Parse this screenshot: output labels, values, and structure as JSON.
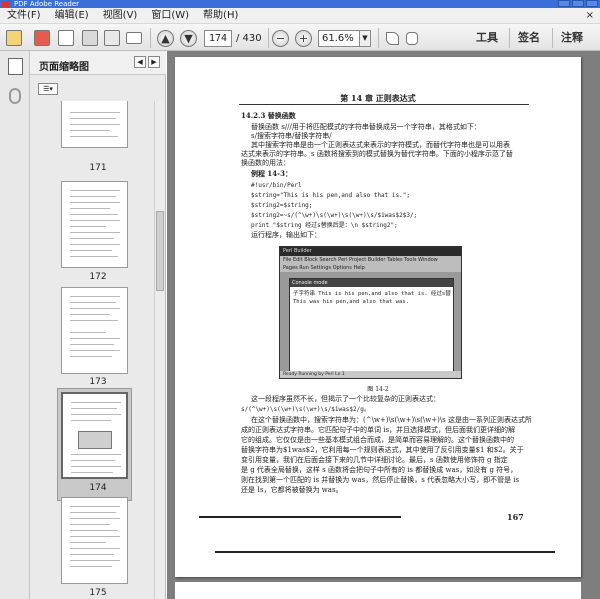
{
  "window": {
    "title": "PDF  Adobe Reader"
  },
  "menu": {
    "file": "文件(F)",
    "edit": "编辑(E)",
    "view": "视图(V)",
    "window": "窗口(W)",
    "help": "帮助(H)",
    "close": "×"
  },
  "toolbar": {
    "page_current": "174",
    "page_total": "/ 430",
    "zoom": "61.6%",
    "tools": "工具",
    "sign": "签名",
    "comment": "注释",
    "icons": [
      "open-icon",
      "create-icon",
      "edit-icon",
      "save-icon",
      "print-icon",
      "email-icon",
      "prev-page-icon",
      "next-page-icon",
      "zoom-out-icon",
      "zoom-in-icon",
      "select-tool-icon",
      "hand-tool-icon"
    ]
  },
  "thumbnails": {
    "title": "页面缩略图",
    "pages": [
      {
        "label": "171",
        "selected": false
      },
      {
        "label": "172",
        "selected": false
      },
      {
        "label": "173",
        "selected": false
      },
      {
        "label": "174",
        "selected": true
      },
      {
        "label": "175",
        "selected": false
      }
    ]
  },
  "page": {
    "header": "第 14 章   正则表达式",
    "section": "14.2.3   替换函数",
    "lines": [
      "替换函数 s///用于将匹配模式的字符串替换成另一个字符串，其格式如下：",
      "s/搜索字符串/替换字符串/",
      "其中搜索字符串是由一个正则表达式来表示的字符模式，而替代字符串也是可以用表",
      "达式来表示的字符串。s 函数将搜索到的模式替换为替代字符串。下面的小程序示范了替",
      "换函数的用法：",
      "例程 14-3："
    ],
    "code": [
      "#!usr/bin/Perl",
      "$string=\"This is his pen,and also that is.\";",
      "$string2=$string;",
      "$string2=~s/(^\\w+)\\s(\\w+)\\s(\\w+)\\s/$1was$2$3/;",
      "print \"$string 经过s替换后是：\\n $string2\";"
    ],
    "after_code": "运行程序，输出如下：",
    "screenshot": {
      "title": "Perl Builder",
      "menu1": "File  Edit  Block  Search  Perl  Project  Builder  Tables  Tools  Window",
      "menu2": "Pages  Run  Settings  Options  Help",
      "window_title": "Console mode",
      "output1": "子字符串 This is his pen,and also that is. 经过s替换后是：",
      "output2": "This was his pen,and also that was.",
      "status": "Ready  Running by Perl  Ln 1"
    },
    "figure_caption": "图 14-2",
    "para_lines": [
      "这一段程序虽然不长，但揭示了一个比较复杂的正则表达式：",
      "s/(^\\w+)\\s(\\w+)\\s(\\w+)\\s/$1was$2/g。",
      "在这个替换函数中，搜索字符串为：(^\\w+)\\s(\\w+)\\s(\\w+)\\s 这是由一系列正则表达式所组",
      "成的正则表达式字符串。它匹配句子中的单词 is，并且选择模式，但后面我们更详细的解",
      "它的组成。它仅仅是由一些基本模式组合而成，是简单而容易理解的。这个替换函数中的",
      "替换字符串为$1was$2，它利用每一个规则表达式，其中使用了反引用变量$1 和$2。关于",
      "变引用变量，我们在后面会接下来的几节中详细讨论。最后，s 函数使用修饰符 g 指定",
      "是 g 代表全局替换，这样 s 函数将会把句子中所有的 is 都替换成 was，如没有 g 符号，",
      "则在找到第一个匹配的 is 并替换为 was，然后停止替换，s 代表忽略大小写，即不管是 is",
      "还是 Is，它都将被替换为 was。"
    ],
    "page_number": "167"
  }
}
